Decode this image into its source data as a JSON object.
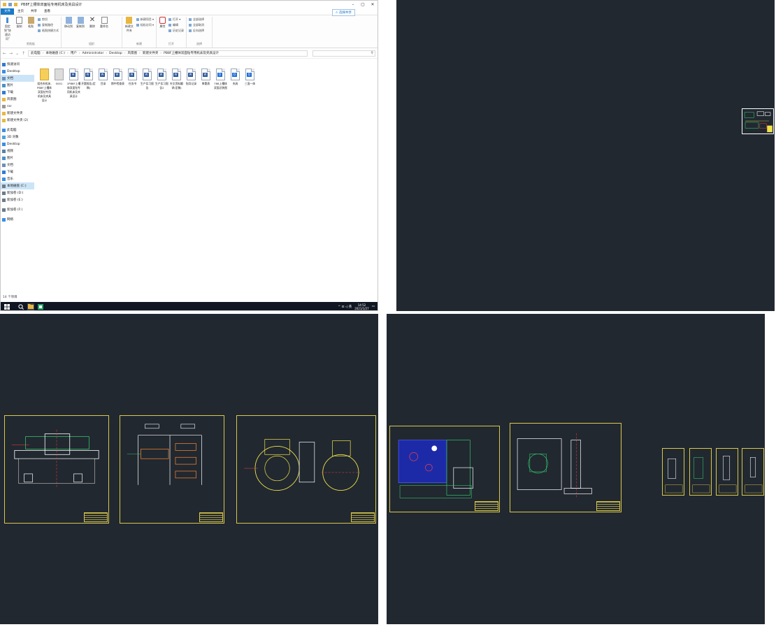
{
  "explorer": {
    "title": "PB8F上槽体双面钻专用机床及夹具设计",
    "menu": [
      "文件",
      "主页",
      "共享",
      "查看"
    ],
    "share_button": "⚠ 选择共享",
    "ribbon": {
      "clipboard": {
        "label": "剪贴板",
        "big": [
          "固定到\"快速访问\"",
          "复制",
          "粘贴"
        ],
        "small": [
          "剪切",
          "复制路径",
          "粘贴快捷方式"
        ]
      },
      "organize": {
        "label": "组织",
        "big": [
          "移动到",
          "复制到",
          "删除",
          "重命名"
        ]
      },
      "new": {
        "label": "新建",
        "big": [
          "新建文件夹"
        ],
        "small": [
          "新建项目 ▾",
          "轻松访问 ▾"
        ]
      },
      "open": {
        "label": "打开",
        "big": [
          "属性"
        ],
        "small": [
          "打开 ▾",
          "编辑",
          "历史记录"
        ]
      },
      "select": {
        "label": "选择",
        "small": [
          "全部选择",
          "全部取消",
          "反向选择"
        ]
      }
    },
    "address": [
      "此电脑",
      "本地磁盘 (C:)",
      "用户",
      "Administrator",
      "Desktop",
      "风景图",
      "新建文件夹",
      "PB8F上槽体双面钻专用机床及夹具设计"
    ],
    "search_icon_glyph": "⚲",
    "tree": [
      {
        "label": "快速访问",
        "icon": "star-icon",
        "color": "#2f7bd6"
      },
      {
        "label": "Desktop",
        "icon": "desktop-icon",
        "color": "#3a8ee6"
      },
      {
        "label": "文档",
        "icon": "document-icon",
        "color": "#6b8fb8",
        "selected": true
      },
      {
        "label": "图片",
        "icon": "picture-icon",
        "color": "#4a90c9"
      },
      {
        "label": "下载",
        "icon": "download-icon",
        "color": "#2f7bd6"
      },
      {
        "label": "风景图",
        "icon": "folder-icon",
        "color": "#e8b740"
      },
      {
        "label": "rar",
        "icon": "search-icon",
        "color": "#999999"
      },
      {
        "label": "新建文件夹",
        "icon": "folder-icon",
        "color": "#e8b740"
      },
      {
        "label": "新建文件夹 (2)",
        "icon": "folder-icon",
        "color": "#e8b740"
      },
      {
        "label": "此电脑",
        "icon": "computer-icon",
        "color": "#3a8ee6",
        "gap": true
      },
      {
        "label": "3D 对象",
        "icon": "cube-icon",
        "color": "#4aa3df"
      },
      {
        "label": "Desktop",
        "icon": "desktop-icon",
        "color": "#3a8ee6"
      },
      {
        "label": "视频",
        "icon": "video-icon",
        "color": "#5b7fa8"
      },
      {
        "label": "图片",
        "icon": "picture-icon",
        "color": "#4a90c9"
      },
      {
        "label": "文档",
        "icon": "document-icon",
        "color": "#6b8fb8"
      },
      {
        "label": "下载",
        "icon": "download-icon",
        "color": "#2f7bd6"
      },
      {
        "label": "音乐",
        "icon": "music-icon",
        "color": "#3a8ee6"
      },
      {
        "label": "本地磁盘 (C:)",
        "icon": "drive-icon",
        "color": "#6b7b8c",
        "selected": true
      },
      {
        "label": "新加卷 (D:)",
        "icon": "drive-icon",
        "color": "#6b7b8c"
      },
      {
        "label": "新加卷 (E:)",
        "icon": "drive-icon",
        "color": "#6b7b8c"
      },
      {
        "label": "新加卷 (F:)",
        "icon": "drive-icon",
        "color": "#6b7b8c",
        "gap": true
      },
      {
        "label": "网络",
        "icon": "network-icon",
        "color": "#3a8ee6",
        "gap": true
      }
    ],
    "files": [
      {
        "name": "组合夹机床-PB8F上槽体双面钻专用机床及夹具设计",
        "type": "folder"
      },
      {
        "name": "0001",
        "type": "zip"
      },
      {
        "name": "1PB8F上槽体双面钻专用机床及夹具设计",
        "type": "doc"
      },
      {
        "name": "开题报告(定稿)",
        "type": "doc"
      },
      {
        "name": "目录",
        "type": "doc"
      },
      {
        "name": "期中检查表",
        "type": "doc"
      },
      {
        "name": "任务书",
        "type": "doc"
      },
      {
        "name": "生产实习报告",
        "type": "doc"
      },
      {
        "name": "生产实习报告2",
        "type": "doc"
      },
      {
        "name": "外文资料翻译(定稿)",
        "type": "doc"
      },
      {
        "name": "指导记录",
        "type": "doc"
      },
      {
        "name": "审题表",
        "type": "doc"
      },
      {
        "name": "788上槽体双面总装图",
        "type": "dwg"
      },
      {
        "name": "夹具",
        "type": "dwg"
      },
      {
        "name": "三面一体",
        "type": "dwg"
      }
    ],
    "status": "14 个项目",
    "taskbar": {
      "time": "14:52",
      "date": "2021/1/27",
      "tray_glyphs": "^ ⊡ ◁ 英"
    }
  },
  "colors": {
    "cad_bg": "#212830",
    "sheet_frame": "#d9c84a",
    "accent": "#1979ca"
  }
}
